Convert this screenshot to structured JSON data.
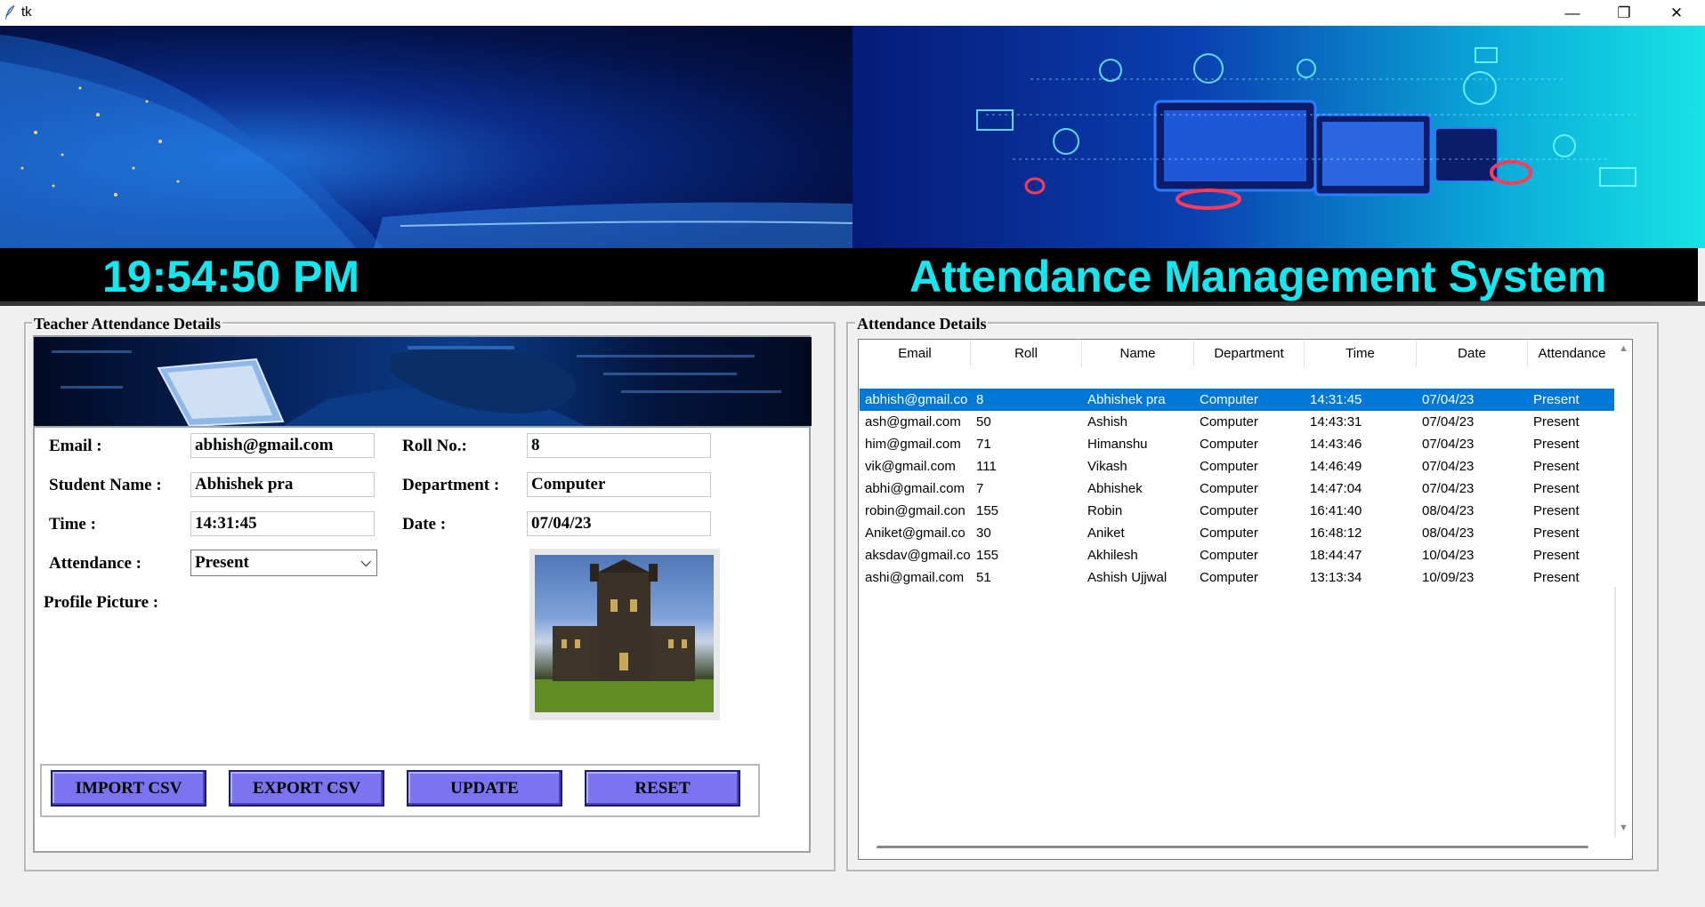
{
  "window": {
    "title": "tk",
    "controls": {
      "minimize": "—",
      "maximize": "❐",
      "close": "✕"
    }
  },
  "header": {
    "clock": "19:54:50 PM",
    "app_title": "Attendance Management System",
    "accent_color": "#14e7ef"
  },
  "form": {
    "legend": "Teacher Attendance Details",
    "email_label": "Email :",
    "email_value": "abhish@gmail.com",
    "roll_label": "Roll No.:",
    "roll_value": "8",
    "name_label": "Student Name :",
    "name_value": "Abhishek pra",
    "department_label": "Department :",
    "department_value": "Computer",
    "time_label": "Time :",
    "time_value": "14:31:45",
    "date_label": "Date :",
    "date_value": "07/04/23",
    "attendance_label": "Attendance :",
    "attendance_value": "Present",
    "profile_label": "Profile Picture :",
    "buttons": {
      "import": "IMPORT CSV",
      "export": "EXPORT CSV",
      "update": "UPDATE",
      "reset": "RESET"
    },
    "button_color": "#7b73ef"
  },
  "table": {
    "legend": "Attendance Details",
    "columns": [
      "Email",
      "Roll",
      "Name",
      "Department",
      "Time",
      "Date",
      "Attendance"
    ],
    "selected_row": 0,
    "selection_color": "#0078d7",
    "rows": [
      [
        "abhish@gmail.co",
        "8",
        "Abhishek pra",
        "Computer",
        "14:31:45",
        "07/04/23",
        "Present"
      ],
      [
        "ash@gmail.com",
        "50",
        "Ashish",
        "Computer",
        "14:43:31",
        "07/04/23",
        "Present"
      ],
      [
        "him@gmail.com",
        "71",
        "Himanshu",
        "Computer",
        "14:43:46",
        "07/04/23",
        "Present"
      ],
      [
        "vik@gmail.com",
        "111",
        "Vikash",
        "Computer",
        "14:46:49",
        "07/04/23",
        "Present"
      ],
      [
        "abhi@gmail.com",
        "7",
        "Abhishek",
        "Computer",
        "14:47:04",
        "07/04/23",
        "Present"
      ],
      [
        "robin@gmail.con",
        "155",
        "Robin",
        "Computer",
        "16:41:40",
        "08/04/23",
        "Present"
      ],
      [
        "Aniket@gmail.co",
        "30",
        "Aniket",
        "Computer",
        "16:48:12",
        "08/04/23",
        "Present"
      ],
      [
        "aksdav@gmail.co",
        "155",
        "Akhilesh",
        "Computer",
        "18:44:47",
        "10/04/23",
        "Present"
      ],
      [
        "ashi@gmail.com",
        "51",
        "Ashish Ujjwal",
        "Computer",
        "13:13:34",
        "10/09/23",
        "Present"
      ]
    ]
  }
}
